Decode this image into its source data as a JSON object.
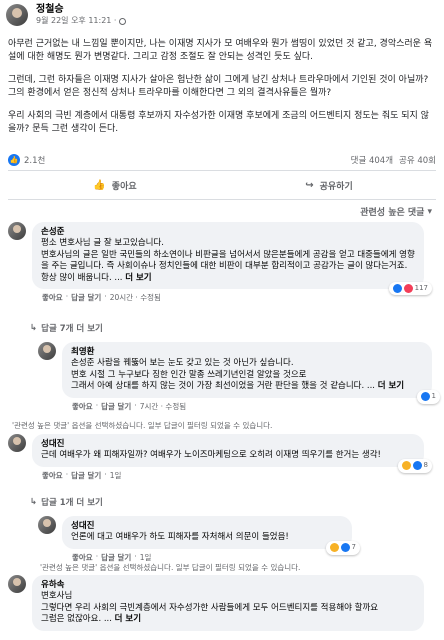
{
  "post": {
    "author": "정철승",
    "meta": "9월 22일 오후 11:21 ·",
    "paragraphs": [
      "아무런 근거없는 내 느낌일 뿐이지만, 나는 이재명 지사가 모 여배우와 뭔가 썸띵이 있었던 것 같고, 경악스러운 욕설에 대한 해명도 뭔가 변명같다. 그리고 감정 조절도 잘 안되는 성격인 듯도 싶다.",
      "그런데, 그런 하자들은 이재명 지사가 살아온 험난한 삶이 그에게 남긴 상처나 트라우마에서 기인된 것이 아닐까? 그의 환경에서 얻은 정신적 상처나 트라우마를 이해한다면 그 외의 결격사유들은 뭘까?",
      "우리 사회의 극빈 계층에서 대통령 후보까지 자수성가한 이재명 후보에게 조금의 어드벤티지 정도는 줘도 되지 않을까? 문득 그런 생각이 든다."
    ],
    "likes": "2.1천",
    "comments_count": "댓글 404개",
    "shares_count": "공유 40회"
  },
  "actions": {
    "like": "좋아요",
    "share": "공유하기"
  },
  "sort_label": "관련성 높은 댓글",
  "comments": [
    {
      "name": "손성준",
      "lines": [
        "평소 변호사님 글 잘 보고있습니다.",
        "변호사님의 글은 일반 국민들의 하소연이나 비판글을 넘어서서 많은분들에게 공감을 얻고 대중들에게 영향을 주는 글입니다. 즉 사회이슈나 정치인들에 대한 비판이 대부분 합리적이고 공감가는 글이 많다는거죠."
      ],
      "last": "항상 많이 배웁니다. ... ",
      "more": "더 보기",
      "like": "좋아요",
      "reply": "답글 달기",
      "time": "20시간 · 수정됨",
      "reactions": "117",
      "replies_link": "답글 7개 더 보기"
    },
    {
      "name": "최영환",
      "lines": [
        "손성준 사람을 꿰뚫어 보는 눈도 갖고 있는 것 아닌가 싶습니다.",
        "변호 시절 그 누구보다 징한 인간 말종 쓰레기년인걸 알았을 것으로",
        "그래서 아예 상대를 하지 않는 것이 가장 최선이었을 거란 판단을 했을 것 같습니다. ... "
      ],
      "more": "더 보기",
      "like": "좋아요",
      "reply": "답글 달기",
      "time": "7시간 · 수정됨",
      "reactions": "1"
    },
    {
      "name": "성대진",
      "lines": [
        "근데 여배우가 왜 피해자일까? 여배우가 노이즈마케팅으로 오히려 이재명 띄우기를 한거는 생각!"
      ],
      "like": "좋아요",
      "reply": "답글 달기",
      "time": "1일",
      "reactions": "8",
      "replies_link": "답글 1개 더 보기"
    },
    {
      "name": "성대진",
      "lines": [
        "언론에 대고 여배우가 하도 피해자를 자처해서 의문이 들었음!"
      ],
      "like": "좋아요",
      "reply": "답글 달기",
      "time": "1일",
      "reactions": "7"
    },
    {
      "name": "유하속",
      "lines": [
        "변호사님",
        "그렇다면 우리 사회의 극빈계층에서 자수성가한 사람들에게 모두 어드벤티지를 적용해야 할까요",
        "그럼은 없잖아요. ... "
      ],
      "more": "더 보기"
    }
  ],
  "notice": {
    "text": "'관련성 높은 댓글' 옵션을 선택하셨습니다. 일부 답글이 필터링 되었을 수 있습니다."
  }
}
